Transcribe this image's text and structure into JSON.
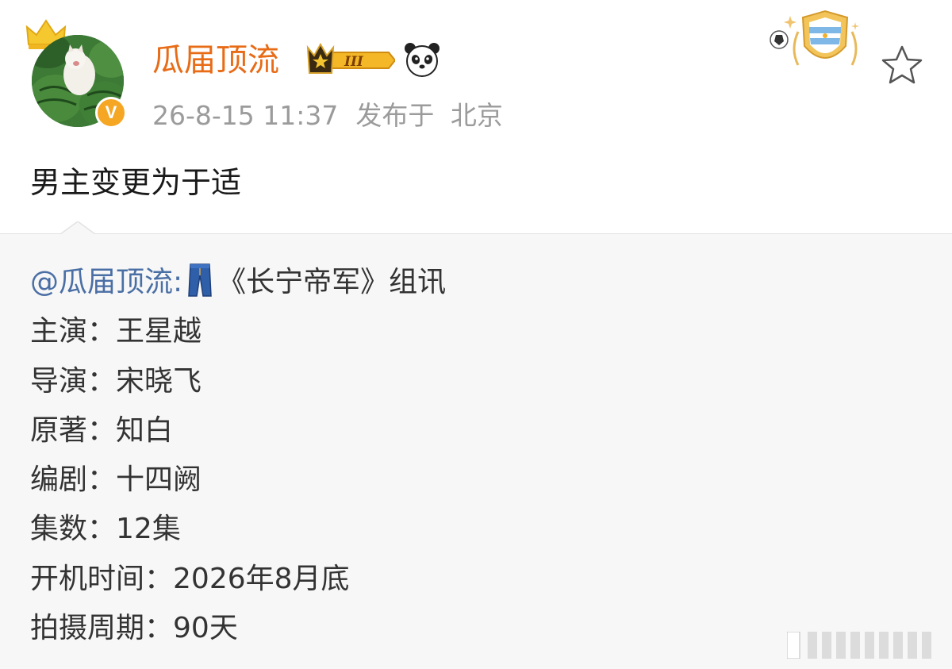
{
  "user": {
    "name": "瓜届顶流",
    "timestamp": "26-8-15 11:37",
    "location_prefix": "发布于",
    "location": "北京",
    "level_badge": "III",
    "verified_badge": "V"
  },
  "post": {
    "text": "男主变更为于适"
  },
  "repost": {
    "mention": "@瓜届顶流:",
    "headline": "《长宁帝军》组讯",
    "details": [
      {
        "label": "主演：",
        "value": "王星越"
      },
      {
        "label": "导演：",
        "value": "宋晓飞"
      },
      {
        "label": "原著：",
        "value": "知白"
      },
      {
        "label": "编剧：",
        "value": "十四阙"
      },
      {
        "label": "集数：",
        "value": "12集"
      },
      {
        "label": "开机时间：",
        "value": "2026年8月底"
      },
      {
        "label": "拍摄周期：",
        "value": "90天"
      }
    ]
  },
  "icons": {
    "crown": "crown-icon",
    "panda": "panda-icon",
    "star": "star-icon",
    "jeans": "jeans-icon",
    "fan_badge": "argentina-football-badge-icon"
  },
  "colors": {
    "username": "#e86b16",
    "mention": "#4a6fa5",
    "meta": "#9b9b9b",
    "repost_bg": "#f7f7f7"
  }
}
